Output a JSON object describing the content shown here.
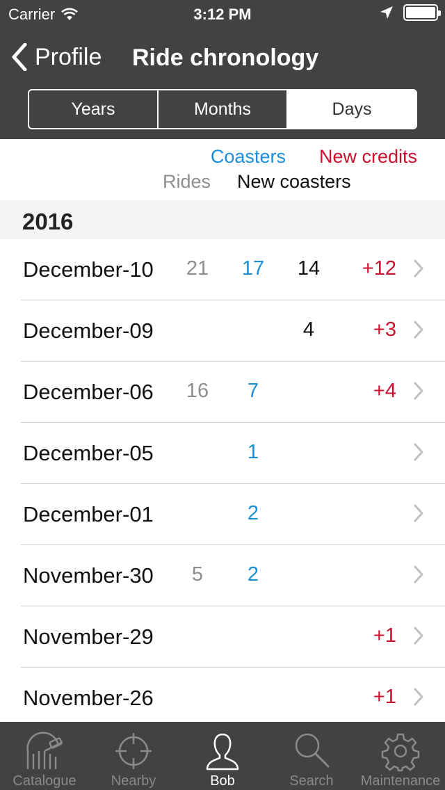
{
  "status": {
    "carrier": "Carrier",
    "time": "3:12 PM"
  },
  "nav": {
    "back_label": "Profile",
    "title": "Ride chronology"
  },
  "segments": [
    {
      "label": "Years",
      "active": false
    },
    {
      "label": "Months",
      "active": false
    },
    {
      "label": "Days",
      "active": true
    }
  ],
  "legend": {
    "coasters": "Coasters",
    "new_credits": "New credits",
    "rides": "Rides",
    "new_coasters": "New coasters"
  },
  "colors": {
    "coasters": "#1a8fd8",
    "new_credits": "#c8102e",
    "rides": "#8e8e8e",
    "new_coasters": "#111111",
    "bar": "#424242"
  },
  "section": {
    "year": "2016"
  },
  "rows": [
    {
      "date": "December-10",
      "rides": "21",
      "coasters": "17",
      "new_coasters": "14",
      "new_credits": "+12"
    },
    {
      "date": "December-09",
      "rides": "",
      "coasters": "",
      "new_coasters": "4",
      "new_credits": "+3"
    },
    {
      "date": "December-06",
      "rides": "16",
      "coasters": "7",
      "new_coasters": "",
      "new_credits": "+4"
    },
    {
      "date": "December-05",
      "rides": "",
      "coasters": "1",
      "new_coasters": "",
      "new_credits": ""
    },
    {
      "date": "December-01",
      "rides": "",
      "coasters": "2",
      "new_coasters": "",
      "new_credits": ""
    },
    {
      "date": "November-30",
      "rides": "5",
      "coasters": "2",
      "new_coasters": "",
      "new_credits": ""
    },
    {
      "date": "November-29",
      "rides": "",
      "coasters": "",
      "new_coasters": "",
      "new_credits": "+1"
    },
    {
      "date": "November-26",
      "rides": "",
      "coasters": "",
      "new_coasters": "",
      "new_credits": "+1"
    }
  ],
  "tabs": [
    {
      "label": "Catalogue",
      "icon": "coaster-icon",
      "active": false
    },
    {
      "label": "Nearby",
      "icon": "crosshair-icon",
      "active": false
    },
    {
      "label": "Bob",
      "icon": "person-icon",
      "active": true
    },
    {
      "label": "Search",
      "icon": "search-icon",
      "active": false
    },
    {
      "label": "Maintenance",
      "icon": "gear-icon",
      "active": false
    }
  ]
}
